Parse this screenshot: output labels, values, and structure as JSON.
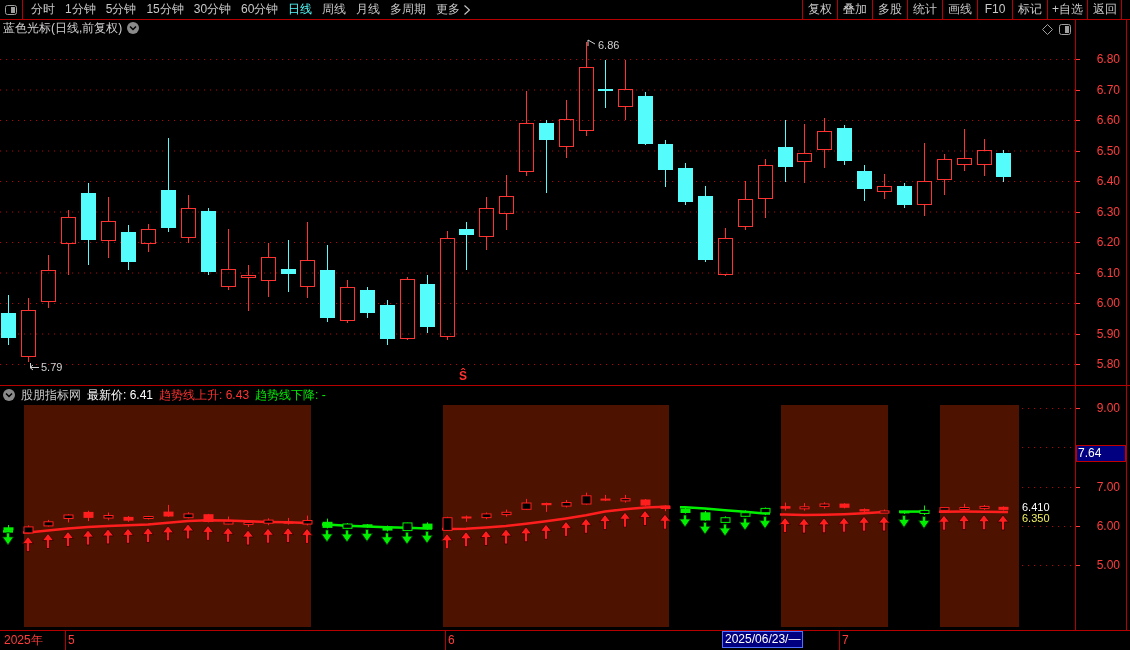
{
  "toolbar": {
    "periods": [
      {
        "label": "分时",
        "selected": false
      },
      {
        "label": "1分钟",
        "selected": false
      },
      {
        "label": "5分钟",
        "selected": false
      },
      {
        "label": "15分钟",
        "selected": false
      },
      {
        "label": "30分钟",
        "selected": false
      },
      {
        "label": "60分钟",
        "selected": false
      },
      {
        "label": "日线",
        "selected": true
      },
      {
        "label": "周线",
        "selected": false
      },
      {
        "label": "月线",
        "selected": false
      },
      {
        "label": "多周期",
        "selected": false
      }
    ],
    "more_menu": "更多",
    "buttons": [
      "复权",
      "叠加",
      "多股",
      "统计",
      "画线",
      "F10",
      "标记",
      "+自选",
      "返回"
    ]
  },
  "price_chart": {
    "title": "蓝色光标(日线,前复权)",
    "y_axis_labels": [
      "6.80",
      "6.70",
      "6.60",
      "6.50",
      "6.40",
      "6.30",
      "6.20",
      "6.10",
      "6.00",
      "5.90",
      "5.80"
    ],
    "high_label": "6.86",
    "low_label": "5.79",
    "signal_marker": "Ŝ"
  },
  "indicator_panel": {
    "name": "股朋指标网",
    "latest_price": "最新价: 6.41",
    "trend_up": "趋势线上升: 6.43",
    "trend_down": "趋势线下降: -",
    "y_axis_labels": [
      "9.00",
      "7.00",
      "6.00",
      "5.00"
    ],
    "cursor_value": "7.64",
    "value_labels": [
      {
        "text": "6.410",
        "color": "#ffffff"
      },
      {
        "text": "6.350",
        "color": "#f0f060"
      }
    ]
  },
  "time_axis": {
    "labels": [
      "2025年",
      "5",
      "6",
      "7"
    ],
    "cursor_date": "2025/06/23/—"
  }
}
